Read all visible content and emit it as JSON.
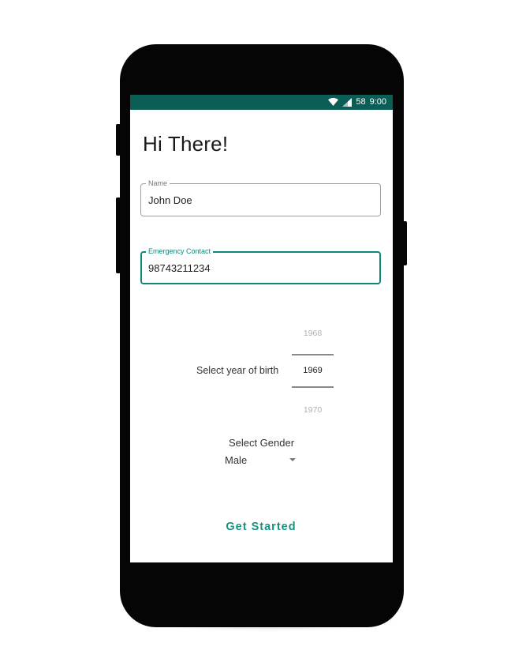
{
  "status_bar": {
    "battery": "58",
    "time": "9:00",
    "icons": [
      "wifi-icon",
      "signal-icon"
    ],
    "background": "#0b5e55"
  },
  "page": {
    "title": "Hi There!"
  },
  "form": {
    "name": {
      "label": "Name",
      "value": "John Doe"
    },
    "emergency_contact": {
      "label": "Emergency Contact",
      "value": "98743211234"
    }
  },
  "year_picker": {
    "caption": "Select year of birth",
    "previous": "1968",
    "selected": "1969",
    "next": "1970"
  },
  "gender": {
    "caption": "Select Gender",
    "selected": "Male"
  },
  "actions": {
    "get_started": "Get Started"
  },
  "colors": {
    "accent": "#17917f",
    "focused_border": "#0d8a7a"
  }
}
